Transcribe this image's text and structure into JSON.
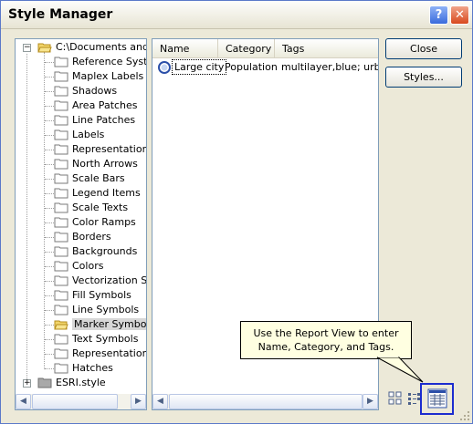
{
  "window": {
    "title": "Style Manager",
    "help_glyph": "?",
    "close_glyph": "✕"
  },
  "tree": {
    "root": "C:\\Documents and S",
    "items": [
      "Reference Syste",
      "Maplex Labels",
      "Shadows",
      "Area Patches",
      "Line Patches",
      "Labels",
      "Representation M",
      "North Arrows",
      "Scale Bars",
      "Legend Items",
      "Scale Texts",
      "Color Ramps",
      "Borders",
      "Backgrounds",
      "Colors",
      "Vectorization Set",
      "Fill Symbols",
      "Line Symbols",
      "Marker Symbols",
      "Text Symbols",
      "Representation R",
      "Hatches"
    ],
    "selected_item": "Marker Symbols",
    "second_root": "ESRI.style"
  },
  "list": {
    "columns": [
      "Name",
      "Category",
      "Tags"
    ],
    "rows": [
      {
        "name": "Large city",
        "category": "Population",
        "tags": "multilayer,blue; urban"
      }
    ]
  },
  "buttons": {
    "close": "Close",
    "styles": "Styles..."
  },
  "callout": {
    "line1": "Use the Report View to enter",
    "line2": "Name, Category, and Tags."
  },
  "view_icons": [
    "large-icons-view-icon",
    "list-view-icon",
    "report-view-icon"
  ],
  "colors": {
    "highlight_box": "#1c2ccf",
    "callout_bg": "#ffffe1",
    "selected_row": "#d7d7d7"
  }
}
